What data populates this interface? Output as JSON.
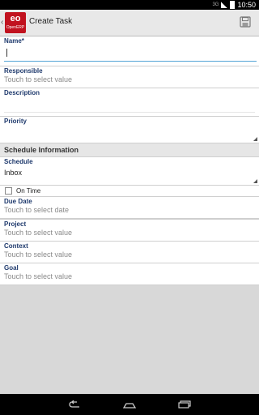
{
  "status_bar": {
    "signal": "3G",
    "time": "10:50"
  },
  "action_bar": {
    "logo_mark": "eo",
    "logo_sub": "OpenERP",
    "title": "Create Task",
    "save_icon": "save-icon"
  },
  "form": {
    "name_label": "Name*",
    "name_value": "",
    "responsible_label": "Responsible",
    "responsible_value": "Touch to select value",
    "description_label": "Description",
    "description_value": "",
    "priority_label": "Priority",
    "priority_value": "",
    "section_schedule": "Schedule Information",
    "schedule_label": "Schedule",
    "schedule_value": "Inbox",
    "on_time_label": "On Time",
    "on_time_checked": false,
    "due_date_label": "Due Date",
    "due_date_value": "Touch to select date",
    "project_label": "Project",
    "project_value": "Touch to select value",
    "context_label": "Context",
    "context_value": "Touch to select value",
    "goal_label": "Goal",
    "goal_value": "Touch to select value"
  },
  "nav_bar": {
    "back_icon": "back-icon",
    "home_icon": "home-icon",
    "recents_icon": "recents-icon"
  },
  "colors": {
    "label_blue": "#1f3a6d",
    "logo_red": "#c1121f",
    "input_underline": "#53a4d6"
  }
}
